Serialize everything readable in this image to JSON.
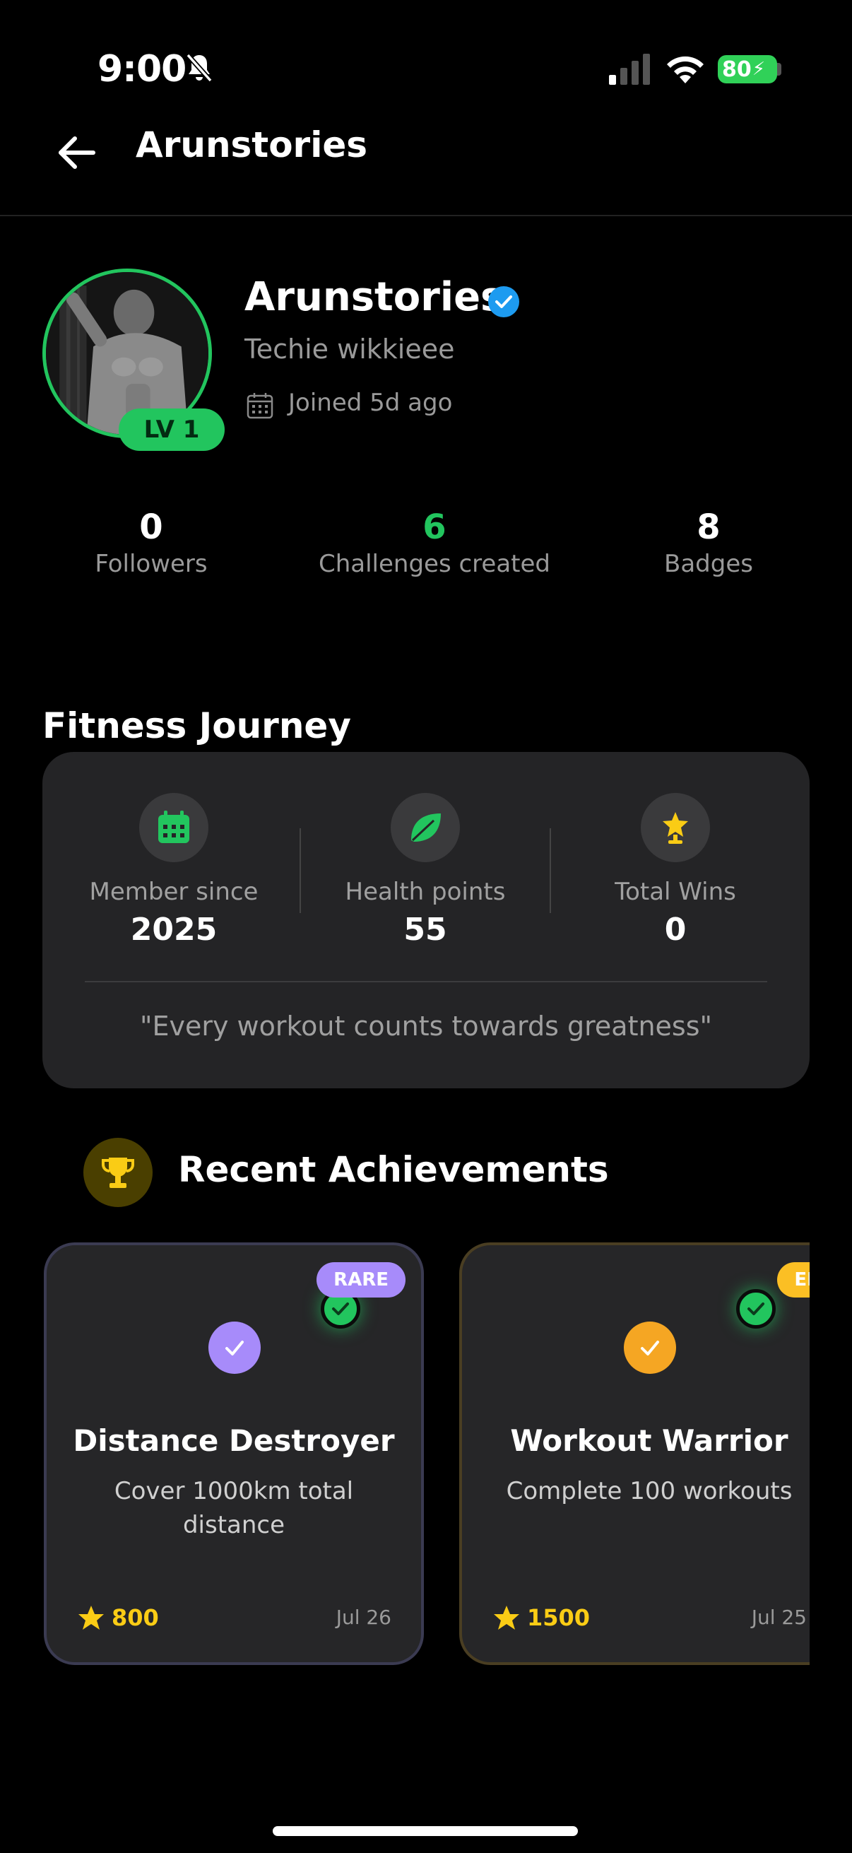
{
  "status_bar": {
    "time": "9:00",
    "battery": "80"
  },
  "header": {
    "title": "Arunstories"
  },
  "profile": {
    "name": "Arunstories",
    "bio": "Techie wikkieee",
    "joined": "Joined 5d ago",
    "level": "LV 1"
  },
  "stats": [
    {
      "value": "0",
      "label": "Followers"
    },
    {
      "value": "6",
      "label": "Challenges created"
    },
    {
      "value": "8",
      "label": "Badges"
    }
  ],
  "journey": {
    "title": "Fitness Journey",
    "items": [
      {
        "label": "Member since",
        "value": "2025",
        "icon": "calendar-icon"
      },
      {
        "label": "Health points",
        "value": "55",
        "icon": "leaf-icon"
      },
      {
        "label": "Total Wins",
        "value": "0",
        "icon": "trophy-star-icon"
      }
    ],
    "quote": "\"Every workout counts towards greatness\""
  },
  "achievements": {
    "title": "Recent Achievements",
    "items": [
      {
        "tag": "RARE",
        "name": "Distance Destroyer",
        "description": "Cover 1000km total distance",
        "points": "800",
        "date": "Jul 26"
      },
      {
        "tag": "EPIC",
        "name": "Workout Warrior",
        "description": "Complete 100 workouts",
        "points": "1500",
        "date": "Jul 25"
      }
    ]
  },
  "colors": {
    "accent_green": "#22c55e",
    "rare_purple": "#a78bfa",
    "epic_gold": "#fbbf24",
    "points_yellow": "#facc15",
    "verified_blue": "#1d9bf0"
  }
}
